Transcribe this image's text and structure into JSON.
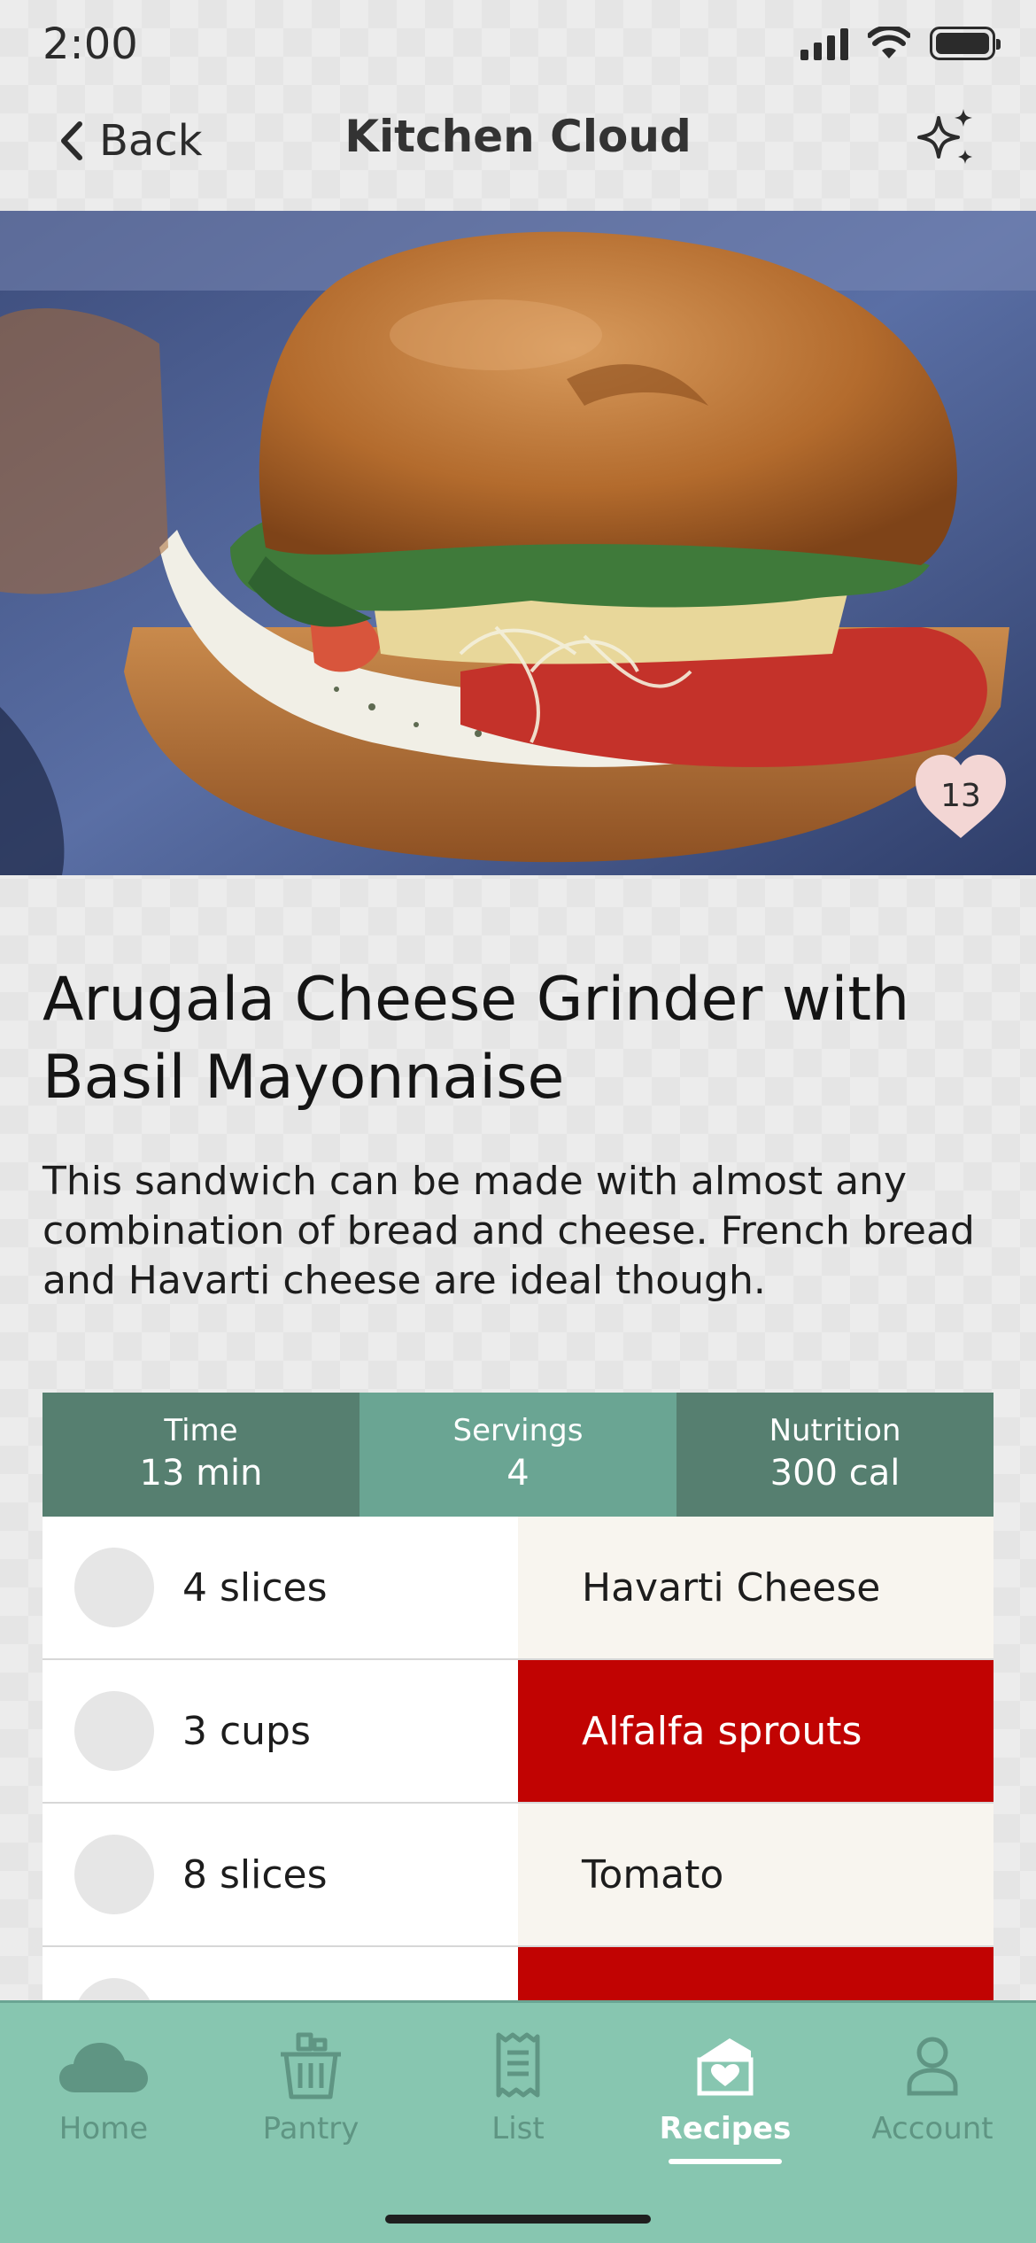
{
  "status": {
    "time": "2:00"
  },
  "nav": {
    "back_label": "Back",
    "title": "Kitchen Cloud",
    "right_icon": "sparkle-icon"
  },
  "hero": {
    "likes": "13"
  },
  "recipe": {
    "title": "Arugala Cheese Grinder with Basil Mayonnaise",
    "description": "This sandwich can be made with almost any combination of bread and cheese. French bread and Havarti cheese are ideal though."
  },
  "stats": [
    {
      "label": "Time",
      "value": "13 min"
    },
    {
      "label": "Servings",
      "value": "4"
    },
    {
      "label": "Nutrition",
      "value": "300 cal"
    }
  ],
  "ingredients": [
    {
      "qty": "4 slices",
      "name": "Havarti Cheese",
      "style": "cream"
    },
    {
      "qty": "3 cups",
      "name": "Alfalfa sprouts",
      "style": "red"
    },
    {
      "qty": "8 slices",
      "name": "Tomato",
      "style": "cream"
    },
    {
      "qty": "",
      "name": "",
      "style": "red"
    }
  ],
  "tabs": [
    {
      "label": "Home",
      "icon": "cloud-icon"
    },
    {
      "label": "Pantry",
      "icon": "basket-icon"
    },
    {
      "label": "List",
      "icon": "receipt-icon"
    },
    {
      "label": "Recipes",
      "icon": "recipe-box-icon",
      "active": true
    },
    {
      "label": "Account",
      "icon": "person-icon"
    }
  ],
  "colors": {
    "stat_dark": "#567f70",
    "stat_light": "#6aa593",
    "accent_red": "#c10302",
    "cream": "#f8f5ef",
    "tab_bar": "#87c6b0"
  }
}
